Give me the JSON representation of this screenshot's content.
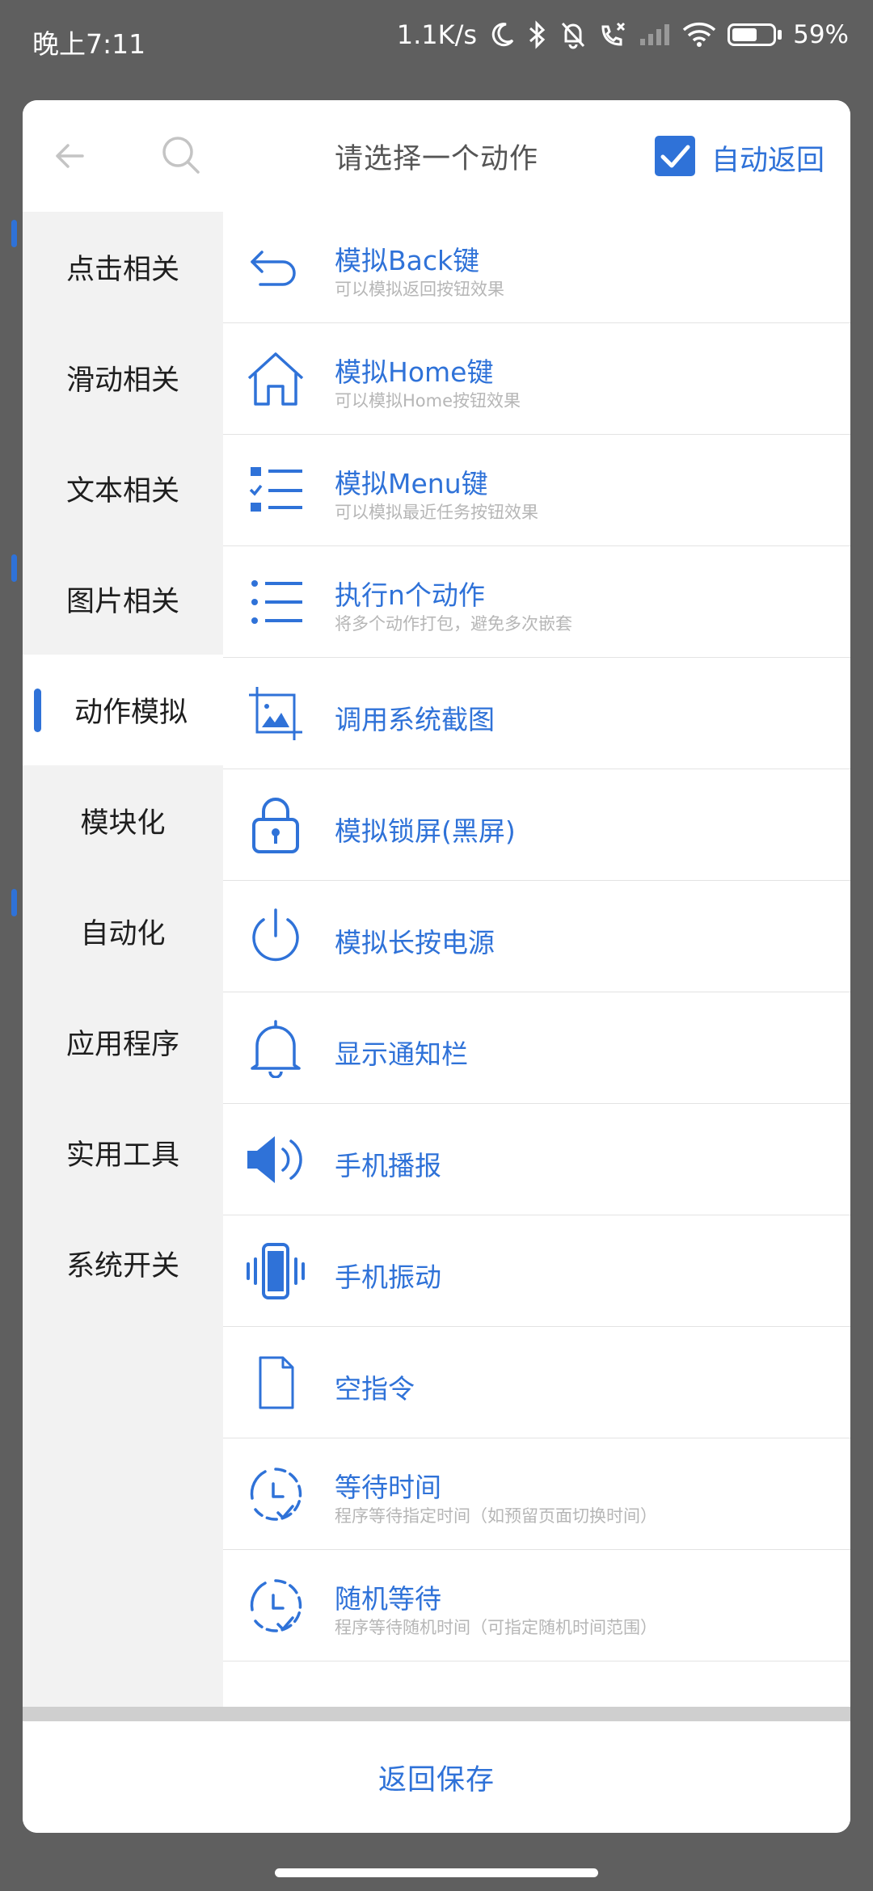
{
  "status_bar": {
    "time": "晚上7:11",
    "net_speed": "1.1K/s",
    "battery_percent": "59%"
  },
  "header": {
    "title": "请选择一个动作",
    "auto_return_label": "自动返回",
    "auto_return_checked": true
  },
  "sidebar": {
    "items": [
      {
        "label": "点击相关"
      },
      {
        "label": "滑动相关"
      },
      {
        "label": "文本相关"
      },
      {
        "label": "图片相关"
      },
      {
        "label": "动作模拟"
      },
      {
        "label": "模块化"
      },
      {
        "label": "自动化"
      },
      {
        "label": "应用程序"
      },
      {
        "label": "实用工具"
      },
      {
        "label": "系统开关"
      }
    ],
    "active_index": 4
  },
  "actions": {
    "items": [
      {
        "title": "模拟Back键",
        "subtitle": "可以模拟返回按钮效果",
        "icon": "back-arrow-icon"
      },
      {
        "title": "模拟Home键",
        "subtitle": "可以模拟Home按钮效果",
        "icon": "home-icon"
      },
      {
        "title": "模拟Menu键",
        "subtitle": "可以模拟最近任务按钮效果",
        "icon": "checklist-icon"
      },
      {
        "title": "执行n个动作",
        "subtitle": "将多个动作打包，避免多次嵌套",
        "icon": "list-icon"
      },
      {
        "title": "调用系统截图",
        "subtitle": "",
        "icon": "screenshot-icon"
      },
      {
        "title": "模拟锁屏(黑屏)",
        "subtitle": "",
        "icon": "lock-icon"
      },
      {
        "title": "模拟长按电源",
        "subtitle": "",
        "icon": "power-icon"
      },
      {
        "title": "显示通知栏",
        "subtitle": "",
        "icon": "bell-icon"
      },
      {
        "title": "手机播报",
        "subtitle": "",
        "icon": "speaker-icon"
      },
      {
        "title": "手机振动",
        "subtitle": "",
        "icon": "vibrate-icon"
      },
      {
        "title": "空指令",
        "subtitle": "",
        "icon": "blank-file-icon"
      },
      {
        "title": "等待时间",
        "subtitle": "程序等待指定时间（如预留页面切换时间）",
        "icon": "timer-icon"
      },
      {
        "title": "随机等待",
        "subtitle": "程序等待随机时间（可指定随机时间范围）",
        "icon": "random-timer-icon"
      }
    ]
  },
  "footer": {
    "save_label": "返回保存"
  },
  "colors": {
    "accent": "#2f72d8",
    "sidebar_bg": "#f2f2f2",
    "subtitle": "#b6b6b6"
  }
}
